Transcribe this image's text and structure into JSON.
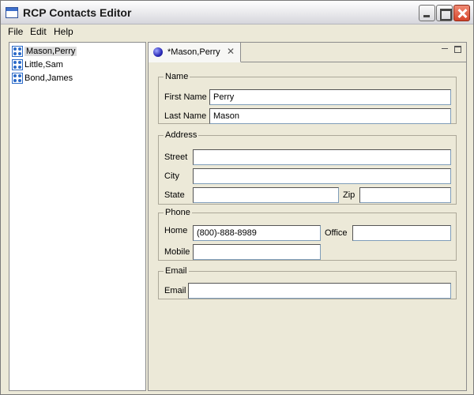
{
  "window": {
    "title": "RCP Contacts Editor"
  },
  "menu": {
    "file": "File",
    "edit": "Edit",
    "help": "Help"
  },
  "contacts": [
    {
      "label": "Mason,Perry",
      "selected": true
    },
    {
      "label": "Little,Sam"
    },
    {
      "label": "Bond,James"
    }
  ],
  "editor": {
    "tab_label": "*Mason,Perry",
    "name": {
      "legend": "Name",
      "first_label": "First Name",
      "first_value": "Perry",
      "last_label": "Last Name",
      "last_value": "Mason"
    },
    "address": {
      "legend": "Address",
      "street_label": "Street",
      "street_value": "",
      "city_label": "City",
      "city_value": "",
      "state_label": "State",
      "state_value": "",
      "zip_label": "Zip",
      "zip_value": ""
    },
    "phone": {
      "legend": "Phone",
      "home_label": "Home",
      "home_value": "(800)-888-8989",
      "office_label": "Office",
      "office_value": "",
      "mobile_label": "Mobile",
      "mobile_value": ""
    },
    "email": {
      "legend": "Email",
      "email_label": "Email",
      "email_value": ""
    }
  },
  "icons": {
    "app": "window-icon",
    "contact": "contact-icon",
    "editor_tab": "contact-editor-icon"
  },
  "colors": {
    "window_bg": "#ece9d8",
    "close_button": "#d6452b"
  }
}
